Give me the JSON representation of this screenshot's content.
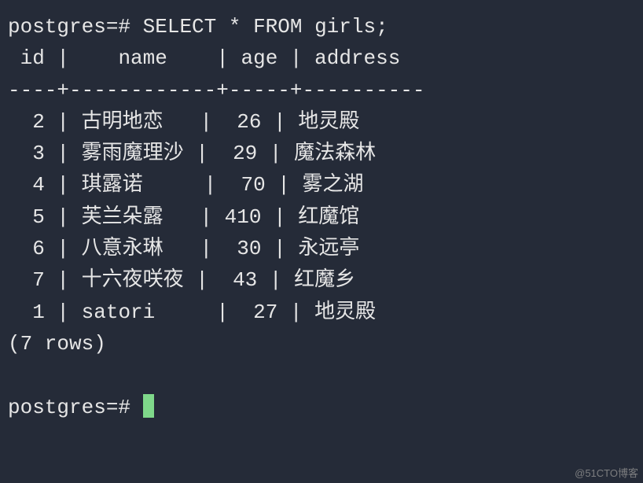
{
  "prompt": "postgres=#",
  "query": "SELECT * FROM girls;",
  "headers": {
    "id": "id",
    "name": "name",
    "age": "age",
    "address": "address"
  },
  "separator": "----+------------+-----+----------",
  "rows": [
    {
      "id": "2",
      "name": "古明地恋",
      "age": "26",
      "address": "地灵殿"
    },
    {
      "id": "3",
      "name": "雾雨魔理沙",
      "age": "29",
      "address": "魔法森林"
    },
    {
      "id": "4",
      "name": "琪露诺",
      "age": "70",
      "address": "雾之湖"
    },
    {
      "id": "5",
      "name": "芙兰朵露",
      "age": "410",
      "address": "红魔馆"
    },
    {
      "id": "6",
      "name": "八意永琳",
      "age": "30",
      "address": "永远亭"
    },
    {
      "id": "7",
      "name": "十六夜咲夜",
      "age": "43",
      "address": "红魔乡"
    },
    {
      "id": "1",
      "name": "satori",
      "age": "27",
      "address": "地灵殿"
    }
  ],
  "row_count_label": "(7 rows)",
  "watermark": "@51CTO博客",
  "chart_data": {
    "type": "table",
    "title": "girls",
    "columns": [
      "id",
      "name",
      "age",
      "address"
    ],
    "data": [
      [
        2,
        "古明地恋",
        26,
        "地灵殿"
      ],
      [
        3,
        "雾雨魔理沙",
        29,
        "魔法森林"
      ],
      [
        4,
        "琪露诺",
        70,
        "雾之湖"
      ],
      [
        5,
        "芙兰朵露",
        410,
        "红魔馆"
      ],
      [
        6,
        "八意永琳",
        30,
        "永远亭"
      ],
      [
        7,
        "十六夜咲夜",
        43,
        "红魔乡"
      ],
      [
        1,
        "satori",
        27,
        "地灵殿"
      ]
    ],
    "row_count": 7
  }
}
